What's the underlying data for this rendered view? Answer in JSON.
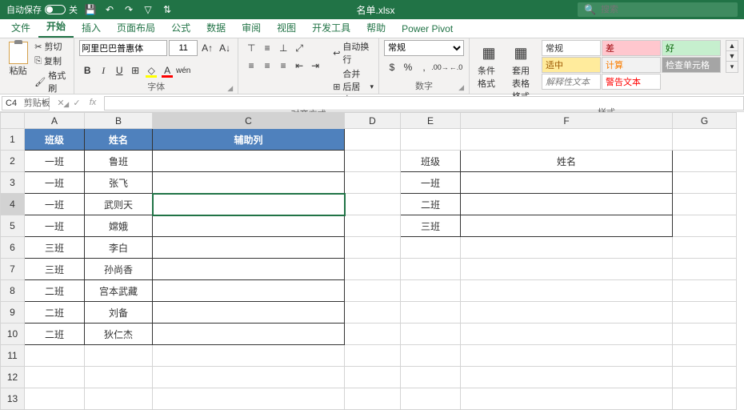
{
  "titlebar": {
    "autosave": "自动保存",
    "autosave_state": "关",
    "filename": "名单.xlsx",
    "search_placeholder": "搜索"
  },
  "tabs": [
    "文件",
    "开始",
    "插入",
    "页面布局",
    "公式",
    "数据",
    "审阅",
    "视图",
    "开发工具",
    "帮助",
    "Power Pivot"
  ],
  "active_tab": 1,
  "ribbon": {
    "clipboard": {
      "paste": "粘贴",
      "cut": "剪切",
      "copy": "复制",
      "format_painter": "格式刷",
      "label": "剪贴板"
    },
    "font": {
      "name": "阿里巴巴普惠体",
      "size": "11",
      "label": "字体"
    },
    "alignment": {
      "wrap": "自动换行",
      "merge": "合并后居中",
      "label": "对齐方式"
    },
    "number": {
      "format": "常规",
      "label": "数字"
    },
    "styles": {
      "cond_format": "条件格式",
      "table_format": "套用\n表格格式",
      "gallery": [
        "常规",
        "差",
        "好",
        "适中",
        "计算",
        "检查单元格",
        "解释性文本",
        "警告文本"
      ],
      "label": "样式"
    }
  },
  "formula_bar": {
    "namebox": "C4",
    "formula": ""
  },
  "columns": [
    "A",
    "B",
    "C",
    "D",
    "E",
    "F",
    "G"
  ],
  "rows": [
    1,
    2,
    3,
    4,
    5,
    6,
    7,
    8,
    9,
    10,
    11,
    12,
    13
  ],
  "active_cell": "C4",
  "chart_data": {
    "type": "table",
    "left_table": {
      "headers": [
        "班级",
        "姓名",
        "辅助列"
      ],
      "rows": [
        [
          "一班",
          "鲁班",
          ""
        ],
        [
          "一班",
          "张飞",
          ""
        ],
        [
          "一班",
          "武则天",
          ""
        ],
        [
          "一班",
          "嫦娥",
          ""
        ],
        [
          "三班",
          "李白",
          ""
        ],
        [
          "三班",
          "孙尚香",
          ""
        ],
        [
          "二班",
          "宫本武藏",
          ""
        ],
        [
          "二班",
          "刘备",
          ""
        ],
        [
          "二班",
          "狄仁杰",
          ""
        ]
      ]
    },
    "right_table": {
      "headers": [
        "班级",
        "姓名"
      ],
      "rows": [
        [
          "一班",
          ""
        ],
        [
          "二班",
          ""
        ],
        [
          "三班",
          ""
        ]
      ]
    }
  }
}
